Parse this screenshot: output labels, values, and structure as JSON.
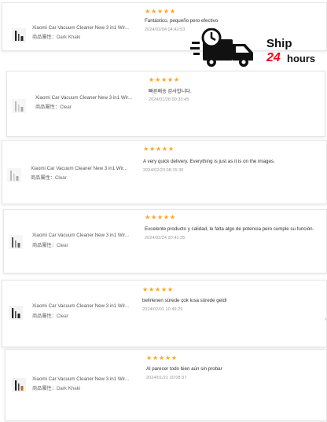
{
  "banner": {
    "ship_label": "Ship",
    "hours_number": "24",
    "hours_label": "hours",
    "icon": "delivery-truck-clock-icon"
  },
  "attr_label": "商品屬性：",
  "reviews": [
    {
      "product_name": "Xiaomi Car Vacuum Cleaner New 3 in1 Wir...",
      "attribute_value": "Dark Khaki",
      "stars": "★★★★★",
      "text": "Fantástico, pequeño pero efectivo",
      "date": "2024/02/04 04:42:53"
    },
    {
      "product_name": "Xiaomi Car Vacuum Cleaner New 3 in1 Wir...",
      "attribute_value": "Clear",
      "stars": "★★★★★",
      "text": "빠른배송 감사합니다.",
      "date": "2024/01/28 00:33:45"
    },
    {
      "product_name": "Xiaomi Car Vacuum Cleaner New 3 in1 Wir...",
      "attribute_value": "Clear",
      "stars": "★★★★★",
      "text": "A very quick delivery. Everything is just as it is on the images.",
      "date": "2024/02/23 08:15:30"
    },
    {
      "product_name": "Xiaomi Car Vacuum Cleaner New 3 in1 Wir...",
      "attribute_value": "Clear",
      "stars": "★★★★★",
      "text": "Excelente producto y calidad, le falta algo de potencia pero cumple su función.",
      "date": "2024/02/24 20:41:35"
    },
    {
      "product_name": "Xiaomi Car Vacuum Cleaner New 3 in1 Wir...",
      "attribute_value": "Clear",
      "stars": "★★★★★",
      "text": "belirlenen sürede çok kısa sürede geldi",
      "date": "2024/02/01 10:49:29"
    },
    {
      "product_name": "Xiaomi Car Vacuum Cleaner New 3 in1 Wir...",
      "attribute_value": "Dark Khaki",
      "stars": "★★★★★",
      "text": "Al parecer todo bien aún sin probar",
      "date": "2024/01/21 20:08:37"
    }
  ],
  "colors": {
    "star": "#ffa41c",
    "hours_red": "#e3101a",
    "card_border": "#e6e6e6"
  }
}
